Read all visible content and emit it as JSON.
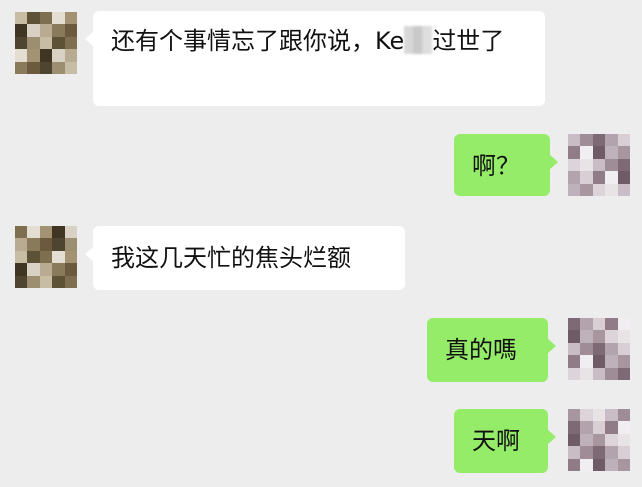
{
  "conversation": {
    "messages": [
      {
        "side": "incoming",
        "text_before": "还有个事情忘了跟你说，Ke",
        "redacted": true,
        "text_after": "过世了"
      },
      {
        "side": "outgoing",
        "text": "啊？"
      },
      {
        "side": "incoming",
        "text": "我这几天忙的焦头烂额"
      },
      {
        "side": "outgoing",
        "text": "真的嗎"
      },
      {
        "side": "outgoing",
        "text": "天啊"
      }
    ]
  },
  "colors": {
    "background": "#ededed",
    "incoming_bubble": "#ffffff",
    "outgoing_bubble": "#95ec69",
    "text": "#111111"
  },
  "icons": {
    "contact_avatar": "pixelated-contact-avatar-icon",
    "user_avatar": "pixelated-user-avatar-icon"
  }
}
